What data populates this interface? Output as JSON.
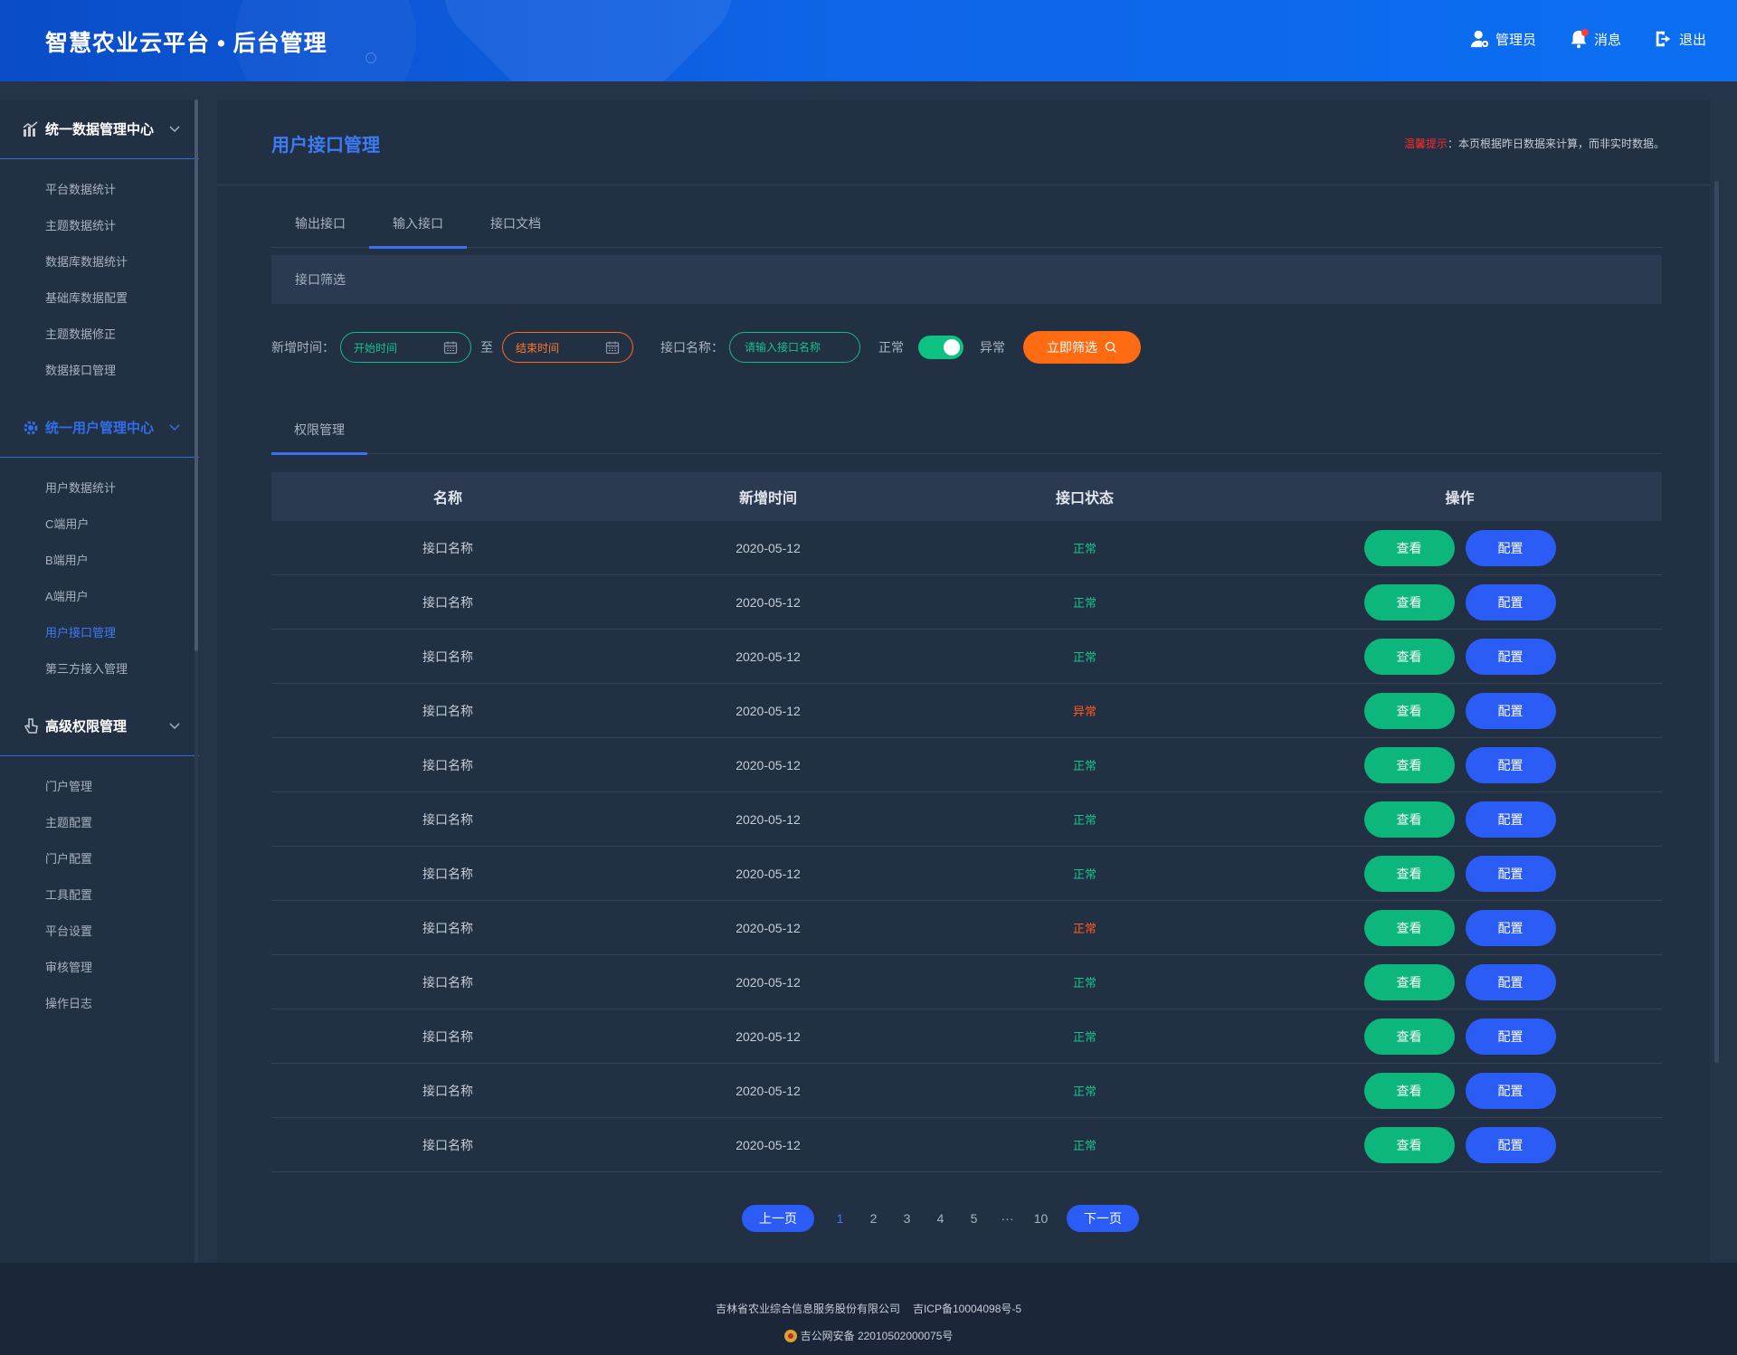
{
  "header": {
    "title": "智慧农业云平台 • 后台管理",
    "actions": {
      "admin": "管理员",
      "messages": "消息",
      "logout": "退出"
    }
  },
  "sidebar": {
    "groups": [
      {
        "title": "统一数据管理中心",
        "icon": "chart-icon",
        "items": [
          "平台数据统计",
          "主题数据统计",
          "数据库数据统计",
          "基础库数据配置",
          "主题数据修正",
          "数据接口管理"
        ]
      },
      {
        "title": "统一用户管理中心",
        "icon": "gear-icon",
        "items": [
          "用户数据统计",
          "C端用户",
          "B端用户",
          "A端用户",
          "用户接口管理",
          "第三方接入管理"
        ],
        "active_item": "用户接口管理"
      },
      {
        "title": "高级权限管理",
        "icon": "hand-pointer-icon",
        "items": [
          "门户管理",
          "主题配置",
          "门户配置",
          "工具配置",
          "平台设置",
          "审核管理",
          "操作日志"
        ]
      }
    ]
  },
  "main": {
    "title": "用户接口管理",
    "notice_label": "温馨提示",
    "notice_text": "：本页根据昨日数据来计算，而非实时数据。",
    "tabs": [
      "输出接口",
      "输入接口",
      "接口文档"
    ],
    "active_tab": "输入接口",
    "filter_section_title": "接口筛选",
    "filter": {
      "date_label": "新增时间：",
      "start_placeholder": "开始时间",
      "to_label": "至",
      "end_placeholder": "结束时间",
      "name_label": "接口名称：",
      "name_placeholder": "请输入接口名称",
      "normal_label": "正常",
      "abnormal_label": "异常",
      "toggle_on": true,
      "submit_label": "立即筛选"
    },
    "sub_tab": "权限管理",
    "table": {
      "headers": [
        "名称",
        "新增时间",
        "接口状态",
        "操作"
      ],
      "view_label": "查看",
      "config_label": "配置",
      "rows": [
        {
          "name": "接口名称",
          "date": "2020-05-12",
          "status": "正常",
          "status_color": "#14c48a"
        },
        {
          "name": "接口名称",
          "date": "2020-05-12",
          "status": "正常",
          "status_color": "#14c48a"
        },
        {
          "name": "接口名称",
          "date": "2020-05-12",
          "status": "正常",
          "status_color": "#14c48a"
        },
        {
          "name": "接口名称",
          "date": "2020-05-12",
          "status": "异常",
          "status_color": "#ff5a1f"
        },
        {
          "name": "接口名称",
          "date": "2020-05-12",
          "status": "正常",
          "status_color": "#14c48a"
        },
        {
          "name": "接口名称",
          "date": "2020-05-12",
          "status": "正常",
          "status_color": "#14c48a"
        },
        {
          "name": "接口名称",
          "date": "2020-05-12",
          "status": "正常",
          "status_color": "#14c48a"
        },
        {
          "name": "接口名称",
          "date": "2020-05-12",
          "status": "正常",
          "status_color": "#ff5a1f"
        },
        {
          "name": "接口名称",
          "date": "2020-05-12",
          "status": "正常",
          "status_color": "#14c48a"
        },
        {
          "name": "接口名称",
          "date": "2020-05-12",
          "status": "正常",
          "status_color": "#14c48a"
        },
        {
          "name": "接口名称",
          "date": "2020-05-12",
          "status": "正常",
          "status_color": "#14c48a"
        },
        {
          "name": "接口名称",
          "date": "2020-05-12",
          "status": "正常",
          "status_color": "#14c48a"
        }
      ]
    },
    "pagination": {
      "prev": "上一页",
      "pages": [
        "1",
        "2",
        "3",
        "4",
        "5",
        "···",
        "10"
      ],
      "current": "1",
      "next": "下一页"
    }
  },
  "footer": {
    "company": "吉林省农业综合信息服务股份有限公司",
    "icp": "吉ICP备10004098号-5",
    "police": "吉公网安备 22010502000075号"
  },
  "colors": {
    "header_blue": "#0f63e6",
    "accent_blue": "#3d7bf5",
    "green": "#0db77b",
    "orange": "#ff6b12",
    "panel": "#223044",
    "background": "#26344a"
  }
}
